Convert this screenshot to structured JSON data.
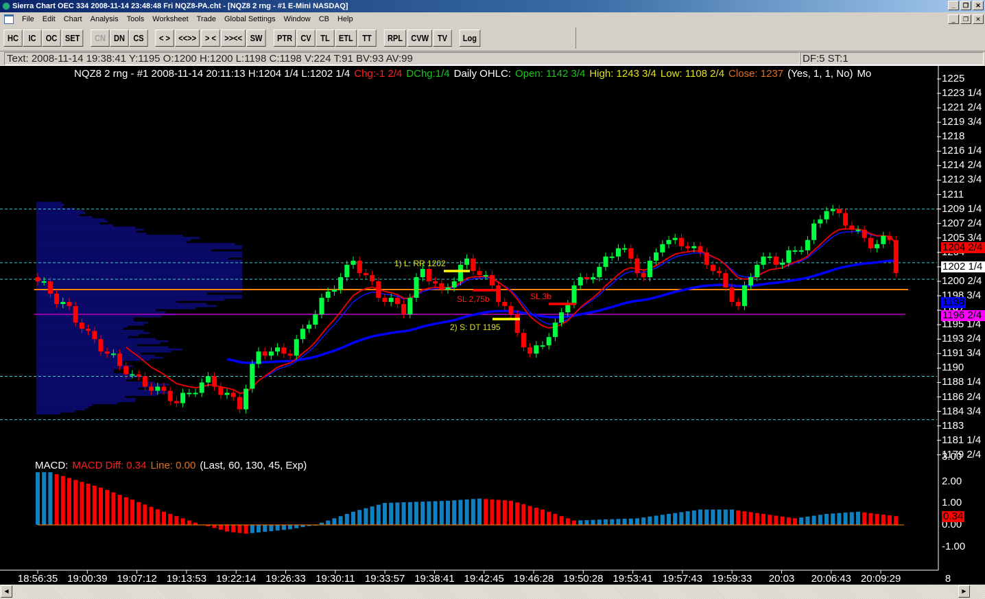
{
  "window": {
    "title": "Sierra Chart OEC 334  2008-11-14  23:48:48  Fri   NQZ8-PA.cht - [NQZ8  2 rng - #1 E-Mini NASDAQ]",
    "min": "_",
    "restore": "❐",
    "close": "✕"
  },
  "menu": [
    "File",
    "Edit",
    "Chart",
    "Analysis",
    "Tools",
    "Worksheet",
    "Trade",
    "Global Settings",
    "Window",
    "CB",
    "Help"
  ],
  "toolbar": [
    [
      "HC",
      "IC",
      "OC",
      "SET"
    ],
    [
      "CN",
      "DN",
      "CS"
    ],
    [
      "< >",
      "<<>>",
      "> <",
      ">><<",
      "SW"
    ],
    [
      "PTR",
      "CV",
      "TL",
      "ETL",
      "TT"
    ],
    [
      "RPL",
      "CVW",
      "TV"
    ],
    [
      "Log"
    ]
  ],
  "disabled_buttons": [
    "CN"
  ],
  "status": {
    "text": "Text: 2008-11-14  19:38:41  Y:1195  O:1200  H:1200  L:1198  C:1198  V:224  T:91  BV:93  AV:99",
    "right": "DF:5  ST:1"
  },
  "header": {
    "symbol": "NQZ8  2 rng - #1  2008-11-14  20:11:13  H:1204 1/4  L:1202 1/4",
    "chg": "Chg:-1 2/4",
    "dchg": "DChg:1/4",
    "daily": "Daily OHLC:",
    "open": "Open: 1142 3/4",
    "high": "High: 1243 3/4",
    "low": "Low: 1108 2/4",
    "close": "Close: 1237",
    "params": "(Yes, 1, 1, No)",
    "trunc": "Mo"
  },
  "price_axis": [
    "1225",
    "1223 1/4",
    "1221 2/4",
    "1219 3/4",
    "1218",
    "1216 1/4",
    "1214 2/4",
    "1212 3/4",
    "1211",
    "1209 1/4",
    "1207 2/4",
    "1205 3/4",
    "1204",
    "1202 1/4",
    "1200 2/4",
    "1198 3/4",
    "1197",
    "1195 1/4",
    "1193 2/4",
    "1191 3/4",
    "1190",
    "1188 1/4",
    "1186 2/4",
    "1184 3/4",
    "1183",
    "1181 1/4",
    "1179 2/4"
  ],
  "price_tags": {
    "last": "1204 2/4",
    "cursor": "1202 1/4",
    "ma": "1198",
    "level": "1196 2/4"
  },
  "macd": {
    "label": "MACD:",
    "diff": "MACD Diff: 0.34",
    "line": "Line: 0.00",
    "params": "(Last, 60, 130, 45, Exp)",
    "axis": [
      "3.00",
      "2.00",
      "1.00",
      "0.00",
      "-1.00"
    ],
    "tag": "0.34"
  },
  "annotations": {
    "long": "1) L: RR 1202",
    "sl1": "SL 2,75b",
    "short": "2) S: DT 1195",
    "sl2": "SL 3b"
  },
  "time_axis": [
    "18:56:35",
    "19:00:39",
    "19:07:12",
    "19:13:53",
    "19:22:14",
    "19:26:33",
    "19:30:11",
    "19:33:57",
    "19:38:41",
    "19:42:45",
    "19:46:28",
    "19:50:28",
    "19:53:41",
    "19:57:43",
    "19:59:33",
    "20:03",
    "20:06:43",
    "20:09:29"
  ],
  "time_axis_extra": "8",
  "colors": {
    "up": "#00ff40",
    "down": "#ff0000",
    "ma_fast": "#1010ff",
    "ma_slow": "#0000ff",
    "ma_red": "#e00000",
    "profile": "#0a0a6a",
    "orange": "#ff8000",
    "magenta": "#c000c0",
    "cyan": "#40d0d0",
    "macd_up": "#1080c0",
    "macd_down": "#ff0000"
  },
  "chart_data": {
    "type": "candlestick",
    "bar_count": 137,
    "close_anchors": [
      [
        0,
        1200.5
      ],
      [
        5,
        1197
      ],
      [
        8,
        1194
      ],
      [
        15,
        1189
      ],
      [
        22,
        1186
      ],
      [
        27,
        1188.5
      ],
      [
        32,
        1185.5
      ],
      [
        35,
        1192
      ],
      [
        40,
        1192
      ],
      [
        45,
        1198
      ],
      [
        50,
        1203
      ],
      [
        54,
        1199
      ],
      [
        58,
        1197
      ],
      [
        61,
        1202
      ],
      [
        64,
        1199
      ],
      [
        68,
        1203
      ],
      [
        72,
        1200
      ],
      [
        75,
        1196
      ],
      [
        78,
        1191.5
      ],
      [
        82,
        1195
      ],
      [
        85,
        1200
      ],
      [
        89,
        1202
      ],
      [
        92,
        1205
      ],
      [
        96,
        1201
      ],
      [
        99,
        1205.5
      ],
      [
        103,
        1205
      ],
      [
        106,
        1203
      ],
      [
        111,
        1197.5
      ],
      [
        114,
        1203
      ],
      [
        118,
        1203
      ],
      [
        122,
        1205.5
      ],
      [
        125,
        1209.5
      ],
      [
        129,
        1207
      ],
      [
        132,
        1205
      ],
      [
        135,
        1205.5
      ],
      [
        136,
        1202
      ]
    ],
    "levels": {
      "orange": 1199.5,
      "magenta": 1196.5,
      "dashed": [
        1209.25,
        1202.75,
        1200.75,
        1189,
        1183.75
      ]
    },
    "macd_anchors": [
      [
        0,
        2.4
      ],
      [
        2,
        2.4
      ],
      [
        10,
        1.7
      ],
      [
        20,
        0.6
      ],
      [
        25,
        0.1
      ],
      [
        30,
        -0.3
      ],
      [
        33,
        -0.4
      ],
      [
        40,
        -0.2
      ],
      [
        44,
        0
      ],
      [
        50,
        0.6
      ],
      [
        55,
        1.0
      ],
      [
        65,
        1.1
      ],
      [
        70,
        1.2
      ],
      [
        75,
        1.1
      ],
      [
        80,
        0.7
      ],
      [
        85,
        0.2
      ],
      [
        95,
        0.3
      ],
      [
        100,
        0.5
      ],
      [
        105,
        0.7
      ],
      [
        110,
        0.7
      ],
      [
        115,
        0.5
      ],
      [
        120,
        0.3
      ],
      [
        125,
        0.5
      ],
      [
        130,
        0.6
      ],
      [
        136,
        0.4
      ]
    ],
    "price_range": [
      1179.5,
      1225
    ],
    "macd_range": [
      -1.5,
      3.0
    ]
  }
}
